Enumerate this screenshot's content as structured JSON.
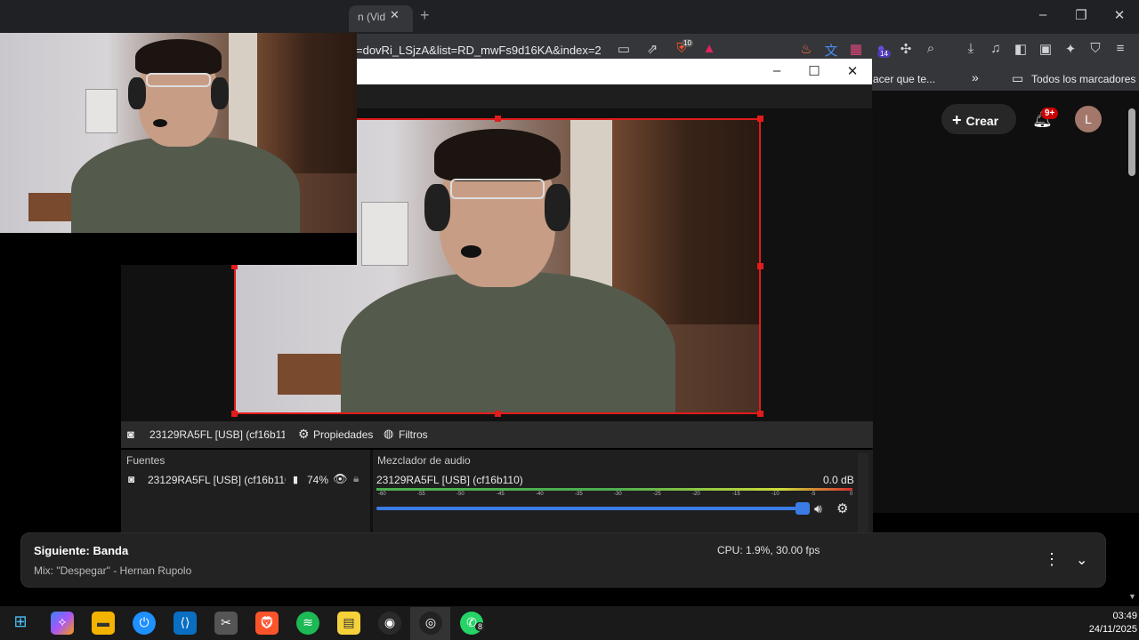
{
  "browser": {
    "tab_title": "n (Vid",
    "url": "=dovRi_LSjzA&list=RD_mwFs9d16KA&index=2",
    "ext_badge_10": "10",
    "ext_badge_14": "14",
    "bookmark_partial": "acer que te...",
    "bookmarks_more": "»",
    "bookmarks_folder": "Todos los marcadores"
  },
  "youtube": {
    "create_label": "Crear",
    "notif_badge": "9+",
    "avatar_letter": "L"
  },
  "obs": {
    "source_toolbar_name": "23129RA5FL [USB] (cf16b110",
    "properties_label": "Propiedades",
    "filters_label": "Filtros",
    "sources_dock_title": "Fuentes",
    "source_item_name": "23129RA5FL [USB] (cf16b110)",
    "source_item_percent": "74%",
    "mixer_dock_title": "Mezclador de audio",
    "mixer_source_name": "23129RA5FL [USB] (cf16b110)",
    "mixer_db": "0.0 dB",
    "vu_ticks": [
      "-60",
      "-55",
      "-50",
      "-45",
      "-40",
      "-35",
      "-30",
      "-25",
      "-20",
      "-15",
      "-10",
      "-5",
      "0"
    ],
    "volume_fraction": 1.0,
    "status_cpu": "CPU: 1.9%, 30.00 fps"
  },
  "notification": {
    "title": "Siguiente: Banda",
    "subtitle": "Mix: \"Despegar\" - Hernan Rupolo"
  },
  "taskbar": {
    "whatsapp_badge": "8",
    "time": "03:49",
    "date": "24/11/2025"
  },
  "colors": {
    "selection_red": "#e21b1b",
    "accent_blue": "#3b7ce4"
  }
}
